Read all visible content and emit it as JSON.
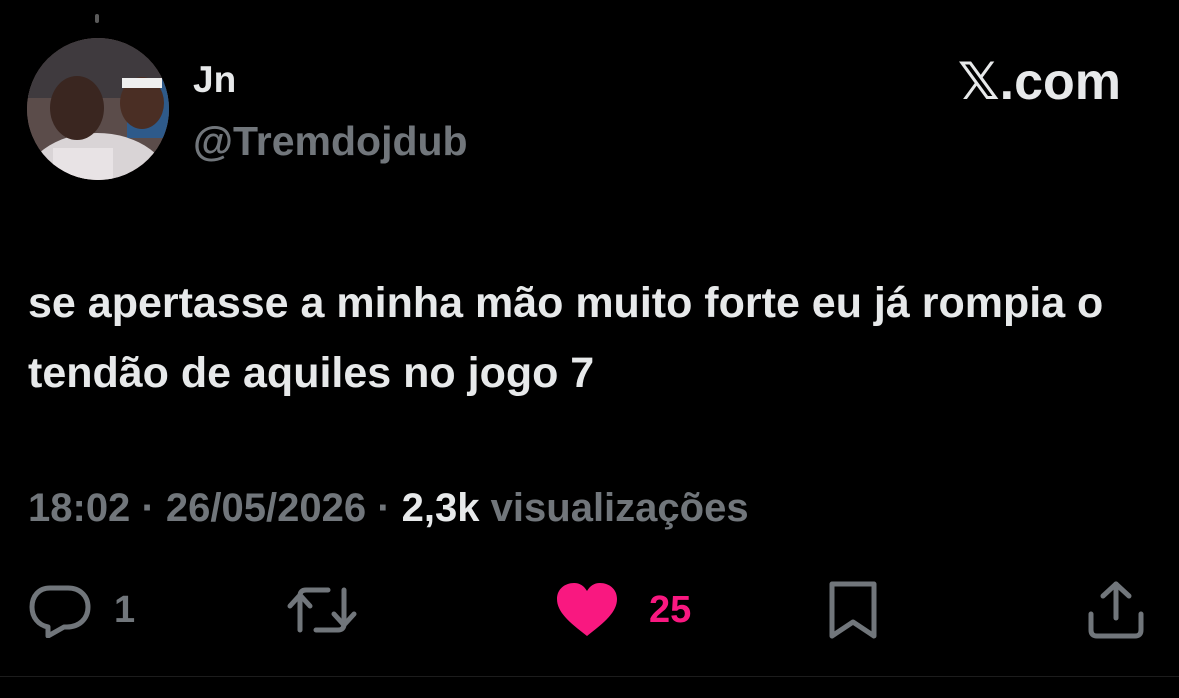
{
  "author": {
    "display_name": "Jn",
    "handle": "@Tremdojdub"
  },
  "brand": {
    "label": "𝕏.com"
  },
  "tweet": {
    "text": "se apertasse a minha mão muito forte eu já rompia o tendão de aquiles no jogo 7"
  },
  "meta": {
    "time": "18:02",
    "separator": "·",
    "date": "26/05/2026",
    "views_count": "2,3k",
    "views_label": "visualizações"
  },
  "actions": {
    "reply_count": "1",
    "retweet_count": "",
    "like_count": "25"
  },
  "icons": {
    "reply": "reply-icon",
    "retweet": "retweet-icon",
    "like": "heart-icon",
    "bookmark": "bookmark-icon",
    "share": "share-icon"
  },
  "colors": {
    "background": "#000000",
    "text_primary": "#e7e9ea",
    "text_secondary": "#71767b",
    "like_active": "#f91880"
  }
}
